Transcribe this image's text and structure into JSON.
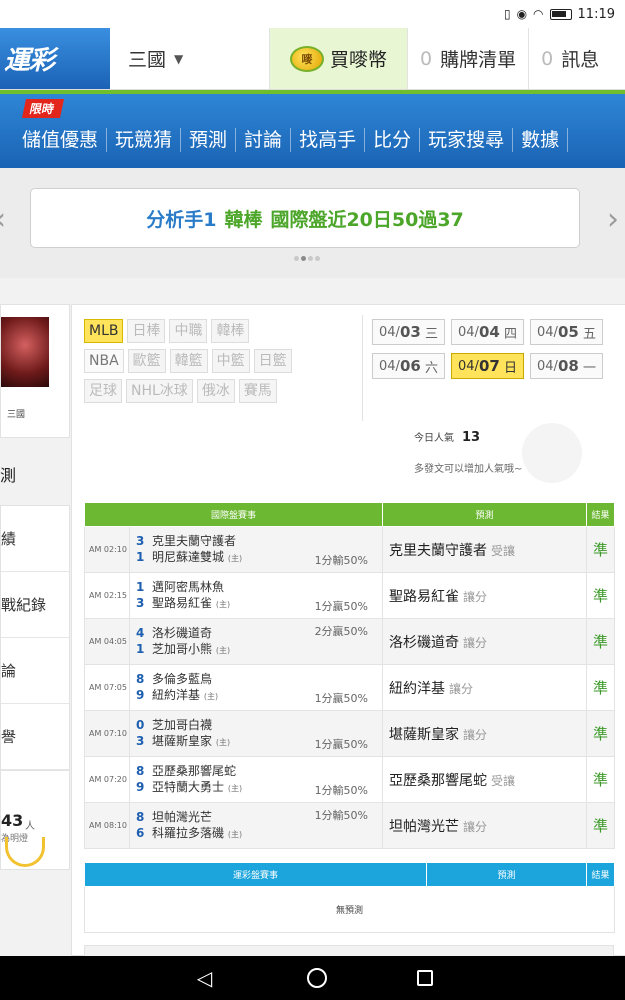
{
  "status": {
    "time": "11:19"
  },
  "header": {
    "logo": "運彩",
    "region": "三國",
    "buy_label": "買嘜幣",
    "coin_label": "嘜",
    "list_count": "0",
    "list_label": "購牌清單",
    "msg_count": "0",
    "msg_label": "訊息"
  },
  "nav": {
    "limited": "限時",
    "items": [
      "儲值優惠",
      "玩競猜",
      "預測",
      "討論",
      "找高手",
      "比分",
      "玩家搜尋",
      "數據"
    ]
  },
  "banner": {
    "prefix": "分析手1",
    "name": "韓棒",
    "text": "國際盤近20日50過37"
  },
  "side": {
    "username": "三國",
    "title": "測",
    "menu": [
      "績",
      "戰紀錄",
      "論",
      "譽"
    ],
    "count": "43",
    "count_unit": "人",
    "count_note": "為明燈"
  },
  "sports": {
    "rows": [
      [
        {
          "label": "MLB",
          "state": "active"
        },
        {
          "label": "日棒",
          "state": "off"
        },
        {
          "label": "中職",
          "state": "off"
        },
        {
          "label": "韓棒",
          "state": "off"
        }
      ],
      [
        {
          "label": "NBA",
          "state": "normal"
        },
        {
          "label": "歐籃",
          "state": "off"
        },
        {
          "label": "韓籃",
          "state": "off"
        },
        {
          "label": "中籃",
          "state": "off"
        },
        {
          "label": "日籃",
          "state": "off"
        }
      ],
      [
        {
          "label": "足球",
          "state": "off"
        },
        {
          "label": "NHL冰球",
          "state": "off"
        },
        {
          "label": "俄冰",
          "state": "off"
        },
        {
          "label": "賽馬",
          "state": "off"
        }
      ]
    ]
  },
  "dates": [
    {
      "md": "04/",
      "d": "03",
      "w": "三",
      "active": false
    },
    {
      "md": "04/",
      "d": "04",
      "w": "四",
      "active": false
    },
    {
      "md": "04/",
      "d": "05",
      "w": "五",
      "active": false
    },
    {
      "md": "04/",
      "d": "06",
      "w": "六",
      "active": false
    },
    {
      "md": "04/",
      "d": "07",
      "w": "日",
      "active": true
    },
    {
      "md": "04/",
      "d": "08",
      "w": "一",
      "active": false
    }
  ],
  "popularity": {
    "label": "今日人氣",
    "value": "13",
    "note": "多發文可以增加人氣哦~"
  },
  "intl_table": {
    "headers": [
      "國際盤賽事",
      "預測",
      "結果"
    ],
    "rows": [
      {
        "time": "AM 02:10",
        "s1": "3",
        "t1": "克里夫蘭守護者",
        "s2": "1",
        "t2": "明尼蘇達雙城",
        "tag": "(主)",
        "spread": "1分輸50%",
        "spread_pos": "bot",
        "pred": "克里夫蘭守護者",
        "ptype": "受讓",
        "res": "準"
      },
      {
        "time": "AM 02:15",
        "s1": "1",
        "t1": "邁阿密馬林魚",
        "s2": "3",
        "t2": "聖路易紅雀",
        "tag": "(主)",
        "spread": "1分贏50%",
        "spread_pos": "bot",
        "pred": "聖路易紅雀",
        "ptype": "讓分",
        "res": "準"
      },
      {
        "time": "AM 04:05",
        "s1": "4",
        "t1": "洛杉磯道奇",
        "s2": "1",
        "t2": "芝加哥小熊",
        "tag": "(主)",
        "spread": "2分贏50%",
        "spread_pos": "top",
        "pred": "洛杉磯道奇",
        "ptype": "讓分",
        "res": "準"
      },
      {
        "time": "AM 07:05",
        "s1": "8",
        "t1": "多倫多藍鳥",
        "s2": "9",
        "t2": "紐約洋基",
        "tag": "(主)",
        "spread": "1分贏50%",
        "spread_pos": "bot",
        "pred": "紐約洋基",
        "ptype": "讓分",
        "res": "準"
      },
      {
        "time": "AM 07:10",
        "s1": "0",
        "t1": "芝加哥白襪",
        "s2": "3",
        "t2": "堪薩斯皇家",
        "tag": "(主)",
        "spread": "1分贏50%",
        "spread_pos": "bot",
        "pred": "堪薩斯皇家",
        "ptype": "讓分",
        "res": "準"
      },
      {
        "time": "AM 07:20",
        "s1": "8",
        "t1": "亞歷桑那響尾蛇",
        "s2": "9",
        "t2": "亞特蘭大勇士",
        "tag": "(主)",
        "spread": "1分輸50%",
        "spread_pos": "bot",
        "pred": "亞歷桑那響尾蛇",
        "ptype": "受讓",
        "res": "準"
      },
      {
        "time": "AM 08:10",
        "s1": "8",
        "t1": "坦帕灣光芒",
        "s2": "6",
        "t2": "科羅拉多落磯",
        "tag": "(主)",
        "spread": "1分輸50%",
        "spread_pos": "top",
        "pred": "坦帕灣光芒",
        "ptype": "讓分",
        "res": "準"
      }
    ]
  },
  "lottery_table": {
    "headers": [
      "運彩盤賽事",
      "預測",
      "結果"
    ],
    "empty": "無預測"
  }
}
